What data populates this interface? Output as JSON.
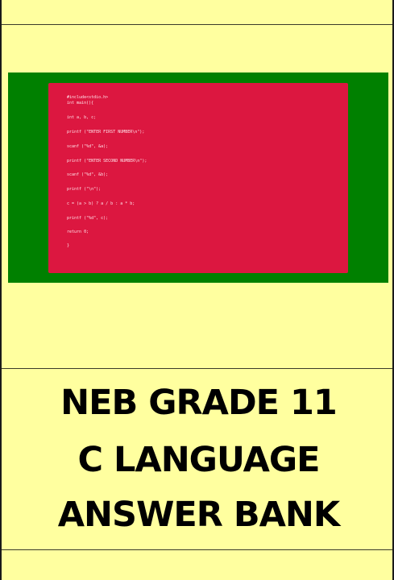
{
  "code": {
    "lines": [
      "#include<stdio.h>",
      "int main(){",
      "int a, b, c;",
      "printf (\"ENTER FIRST NUMBER\\n\");",
      "scanf (\"%d\", &a);",
      "printf (\"ENTER SECOND NUMBER\\n\");",
      "scanf (\"%d\", &b);",
      "printf (\"\\n\");",
      "c = (a > b) ? a / b : a * b;",
      "printf (\"%d\", c);",
      "return 0;",
      "}"
    ]
  },
  "title": {
    "line1": "NEB GRADE 11",
    "line2": "C LANGUAGE",
    "line3": "ANSWER BANK"
  },
  "colors": {
    "page_background": "#ffff9f",
    "panel_green": "#008000",
    "code_background": "#dc1740",
    "code_text": "#ffe4ea",
    "title_text": "#000000"
  }
}
